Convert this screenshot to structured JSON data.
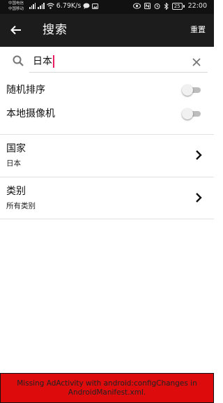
{
  "status_bar": {
    "carrier_1": "中国电信",
    "carrier_2": "中国移动",
    "network_speed": "6.79K/s",
    "battery": "25",
    "time": "22:00"
  },
  "app_bar": {
    "title": "搜索",
    "reset_label": "重置"
  },
  "search": {
    "value": "日本"
  },
  "toggles": [
    {
      "label": "随机排序",
      "on": false
    },
    {
      "label": "本地摄像机",
      "on": false
    }
  ],
  "filters": [
    {
      "label": "国家",
      "value": "日本"
    },
    {
      "label": "类别",
      "value": "所有类别"
    }
  ],
  "error_banner": {
    "message": "Missing AdActivity with android:configChanges in AndroidManifest.xml."
  },
  "colors": {
    "app_bar": "#1c1c1c",
    "status_bar": "#111111",
    "caret": "#e91e63",
    "error_banner": "#dd0b0b"
  }
}
